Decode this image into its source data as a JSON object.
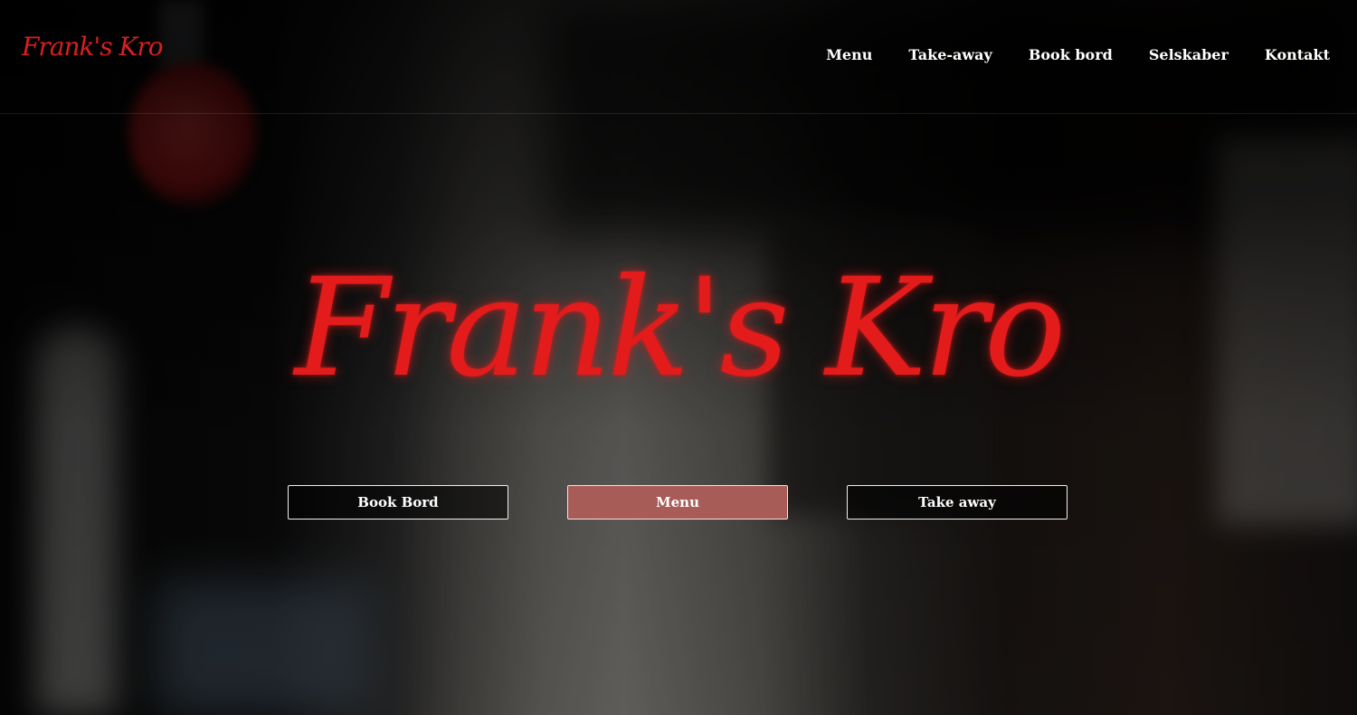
{
  "brand": {
    "logo_text": "Frank's Kro",
    "hero_title": "Frank's Kro"
  },
  "nav": {
    "items": [
      {
        "label": "Menu"
      },
      {
        "label": "Take-away"
      },
      {
        "label": "Book bord"
      },
      {
        "label": "Selskaber"
      },
      {
        "label": "Kontakt"
      }
    ]
  },
  "hero_buttons": {
    "book_bord": "Book Bord",
    "menu": "Menu",
    "take_away": "Take away"
  },
  "colors": {
    "brand_red": "#e31b1b",
    "menu_button_bg": "#a85c58",
    "nav_text": "#ffffff"
  }
}
